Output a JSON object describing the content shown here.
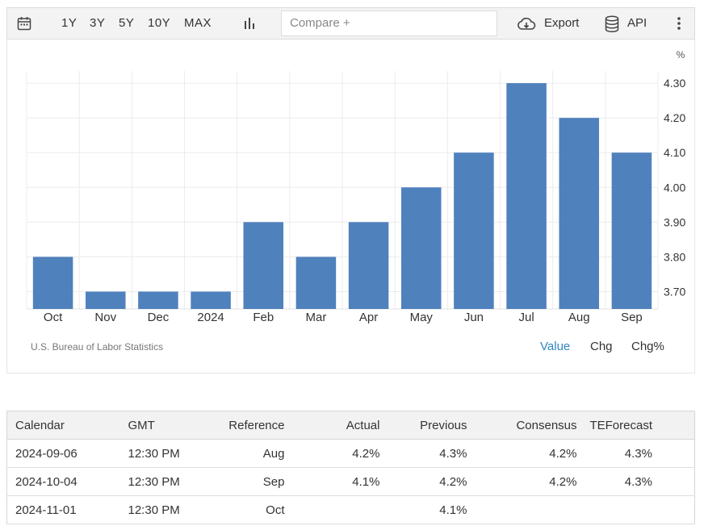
{
  "toolbar": {
    "ranges": [
      "1Y",
      "3Y",
      "5Y",
      "10Y",
      "MAX"
    ],
    "compare_placeholder": "Compare +",
    "export_label": "Export",
    "api_label": "API",
    "icons": [
      "calendar-icon",
      "bar-chart-icon",
      "cloud-download-icon",
      "database-icon",
      "more-vertical-icon"
    ]
  },
  "chart_data": {
    "type": "bar",
    "categories": [
      "Oct",
      "Nov",
      "Dec",
      "2024",
      "Feb",
      "Mar",
      "Apr",
      "May",
      "Jun",
      "Jul",
      "Aug",
      "Sep"
    ],
    "values": [
      3.8,
      3.7,
      3.7,
      3.7,
      3.9,
      3.8,
      3.9,
      4.0,
      4.1,
      4.3,
      4.2,
      4.1
    ],
    "unit_label": "%",
    "yticks": [
      "4.30",
      "4.20",
      "4.10",
      "4.00",
      "3.90",
      "3.80",
      "3.70"
    ],
    "ylim": [
      3.65,
      4.335
    ],
    "grid": true,
    "bar_color": "#4f81bd",
    "source": "U.S. Bureau of Labor Statistics"
  },
  "chart_modes": [
    "Value",
    "Chg",
    "Chg%"
  ],
  "active_mode": "Value",
  "accent_color": "#2e86c1",
  "calendar": {
    "headers": [
      "Calendar",
      "GMT",
      "Reference",
      "Actual",
      "Previous",
      "Consensus",
      "TEForecast"
    ],
    "rows": [
      [
        "2024-09-06",
        "12:30 PM",
        "Aug",
        "4.2%",
        "4.3%",
        "4.2%",
        "4.3%"
      ],
      [
        "2024-10-04",
        "12:30 PM",
        "Sep",
        "4.1%",
        "4.2%",
        "4.2%",
        "4.3%"
      ],
      [
        "2024-11-01",
        "12:30 PM",
        "Oct",
        "",
        "4.1%",
        "",
        ""
      ]
    ]
  }
}
